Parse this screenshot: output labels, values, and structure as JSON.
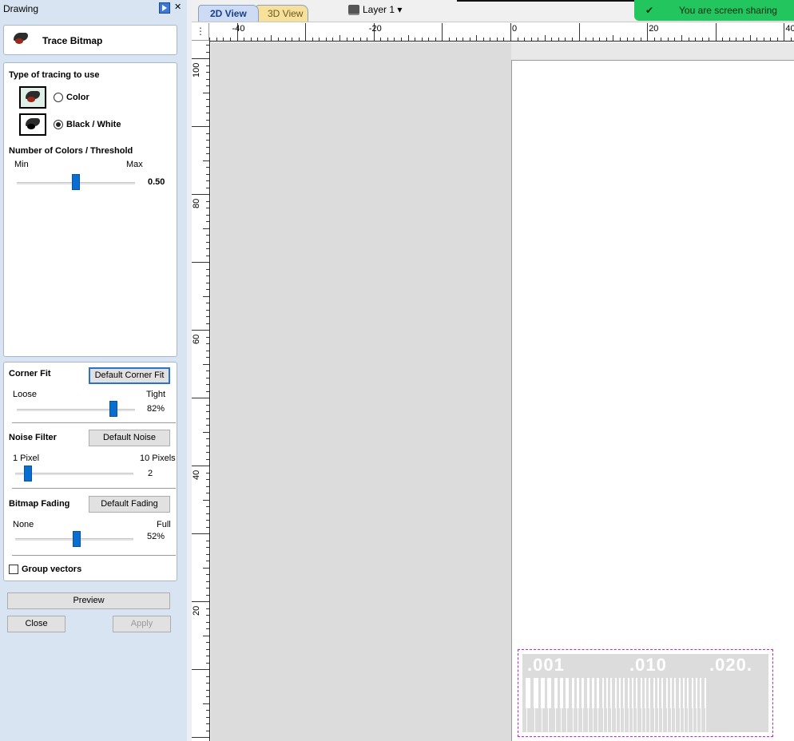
{
  "panel": {
    "title": "Drawing",
    "close_glyph": "✕",
    "pin_icon": "pin-icon"
  },
  "header": {
    "title": "Trace Bitmap",
    "icon": "robin-logo-icon"
  },
  "tracing": {
    "section_title": "Type of tracing to use",
    "options": [
      {
        "label": "Color",
        "selected": false
      },
      {
        "label": "Black / White",
        "selected": true
      }
    ],
    "colors_title": "Number of Colors / Threshold",
    "min_label": "Min",
    "max_label": "Max",
    "threshold_value": "0.50",
    "threshold_level": 0.5
  },
  "corner_fit": {
    "title": "Corner Fit",
    "button": "Default Corner Fit",
    "min_label": "Loose",
    "max_label": "Tight",
    "value": "82%",
    "level": 0.82
  },
  "noise": {
    "title": "Noise Filter",
    "button": "Default Noise",
    "min_label": "1 Pixel",
    "max_label": "10 Pixels",
    "value": "2",
    "level": 0.11
  },
  "fading": {
    "title": "Bitmap Fading",
    "button": "Default Fading",
    "min_label": "None",
    "max_label": "Full",
    "value": "52%",
    "level": 0.52
  },
  "group_vectors": {
    "label": "Group vectors",
    "checked": false
  },
  "actions": {
    "preview": "Preview",
    "close": "Close",
    "apply": "Apply"
  },
  "toolbar": {
    "tab_2d": "2D View",
    "tab_3d": "3D View",
    "layer": "Layer 1 ▾",
    "share": "You are screen sharing",
    "share_icon": "✔",
    "share_color": "#22c55e"
  },
  "ruler": {
    "corner_icon": "⋮",
    "h_labels": [
      "-40",
      "-20",
      "0",
      "20",
      "40"
    ],
    "v_labels": [
      "100",
      "80",
      "60",
      "40",
      "20"
    ]
  },
  "bitmap": {
    "labels": [
      ".001",
      ".010",
      ".020."
    ]
  }
}
